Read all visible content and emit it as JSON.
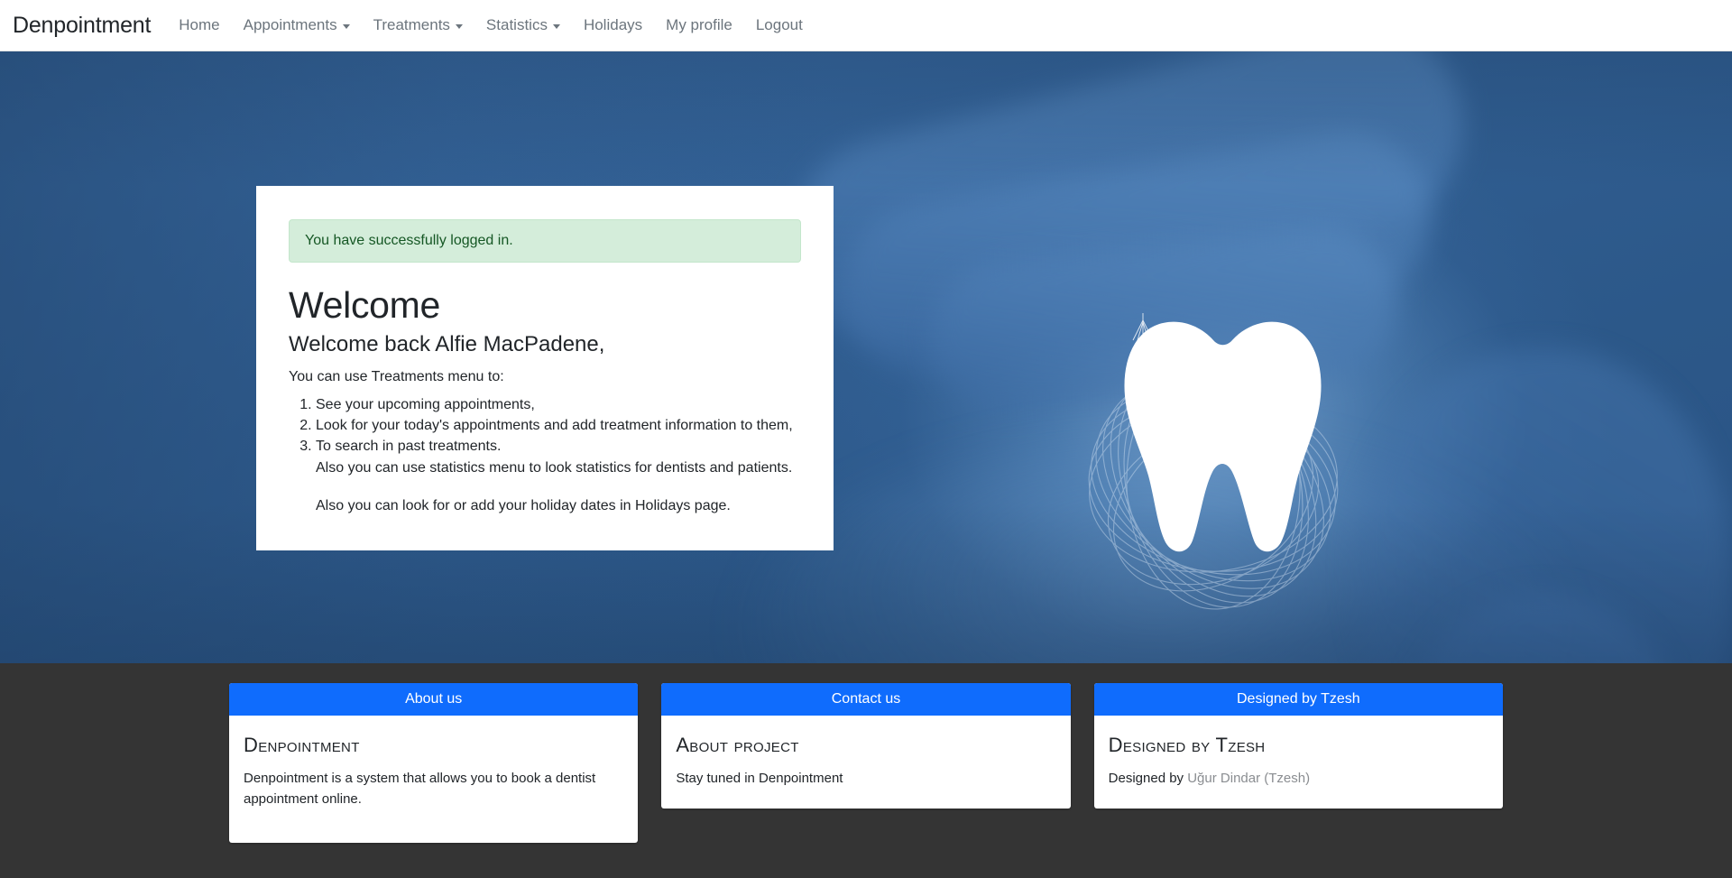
{
  "navbar": {
    "brand": "Denpointment",
    "items": [
      {
        "label": "Home",
        "has_caret": false
      },
      {
        "label": "Appointments",
        "has_caret": true
      },
      {
        "label": "Treatments",
        "has_caret": true
      },
      {
        "label": "Statistics",
        "has_caret": true
      },
      {
        "label": "Holidays",
        "has_caret": false
      },
      {
        "label": "My profile",
        "has_caret": false
      },
      {
        "label": "Logout",
        "has_caret": false
      }
    ]
  },
  "hero": {
    "background_color": "#2e5d90",
    "image_subject": "hand-holding-tooth-illustration"
  },
  "main_card": {
    "alert": {
      "message": "You have successfully logged in.",
      "bg_color": "#d4edda",
      "text_color": "#155724"
    },
    "heading": "Welcome",
    "subheading": "Welcome back Alfie MacPadene,",
    "intro": "You can use Treatments menu to:",
    "tasks": [
      "See your upcoming appointments,",
      "Look for your today's appointments and add treatment information to them,",
      "To search in past treatments."
    ],
    "note_statistics": "Also you can use statistics menu to look statistics for dentists and patients.",
    "note_holidays": "Also you can look for or add your holiday dates in Holidays page."
  },
  "footer": {
    "bg_color": "#343434",
    "header_color": "#0f6cfd",
    "cards": [
      {
        "header": "About us",
        "title": "Denpointment",
        "text": "Denpointment is a system that allows you to book a dentist appointment online."
      },
      {
        "header": "Contact us",
        "title": "About project",
        "text": "Stay tuned in Denpointment"
      },
      {
        "header": "Designed by Tzesh",
        "title": "Designed by Tzesh",
        "text_prefix": "Designed by",
        "link_label": "Uğur Dindar (Tzesh)"
      }
    ]
  }
}
